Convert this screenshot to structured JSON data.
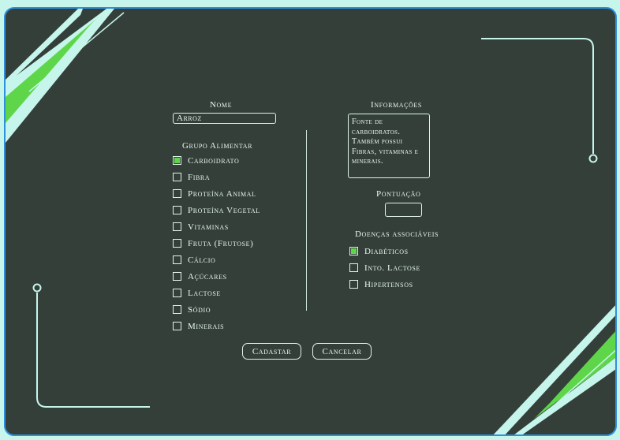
{
  "form": {
    "name_label": "Nome",
    "name_value": "Arroz",
    "group_label": "Grupo Alimentar",
    "groups": [
      {
        "label": "Carboidrato",
        "checked": true
      },
      {
        "label": "Fibra",
        "checked": false
      },
      {
        "label": "Proteína Animal",
        "checked": false
      },
      {
        "label": "Proteína Vegetal",
        "checked": false
      },
      {
        "label": "Vitaminas",
        "checked": false
      },
      {
        "label": "Fruta (Frutose)",
        "checked": false
      },
      {
        "label": "Cálcio",
        "checked": false
      },
      {
        "label": "Açúcares",
        "checked": false
      },
      {
        "label": "Lactose",
        "checked": false
      },
      {
        "label": "Sódio",
        "checked": false
      },
      {
        "label": "Minerais",
        "checked": false
      }
    ],
    "info_label": "Informações",
    "info_value": "Fonte de carboidratos. Também possui Fibras, vitaminas e minerais.",
    "score_label": "Pontuação",
    "score_value": "",
    "diseases_label": "Doenças associáveis",
    "diseases": [
      {
        "label": "Diabéticos",
        "checked": true
      },
      {
        "label": "Into. Lactose",
        "checked": false
      },
      {
        "label": "Hipertensos",
        "checked": false
      }
    ],
    "submit_label": "Cadastar",
    "cancel_label": "Cancelar"
  },
  "colors": {
    "background": "#343f3a",
    "frame": "#2e8fdc",
    "accent_green": "#5fd64a",
    "accent_mint": "#c6f5ec",
    "text": "#e9f7f1"
  }
}
